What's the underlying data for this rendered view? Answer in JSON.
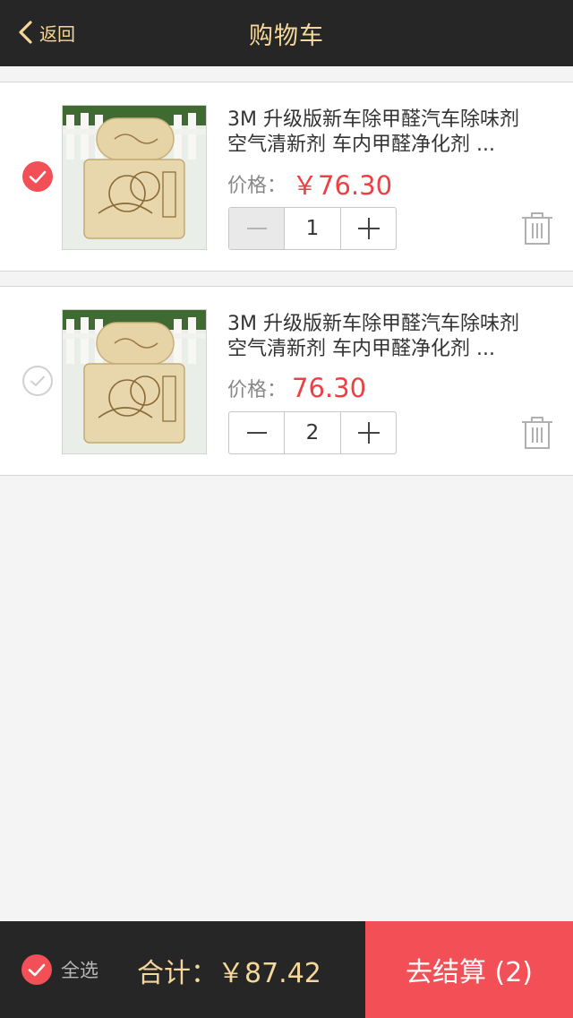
{
  "header": {
    "back_label": "返回",
    "title": "购物车"
  },
  "colors": {
    "header_bg": "#262626",
    "header_text": "#f5d79a",
    "accent": "#f24f57",
    "price": "#ee4042",
    "background": "#f4f4f4"
  },
  "icons": {
    "back": "chevron-left-icon",
    "check": "check-circle-icon",
    "minus": "minus-icon",
    "plus": "plus-icon",
    "trash": "trash-icon"
  },
  "items": [
    {
      "checked": true,
      "name_line1": "3M 升级版新车除甲醛汽车除味剂",
      "name_line2": "空气清新剂 车内甲醛净化剂 ...",
      "price_label": "价格：",
      "price": "￥76.30",
      "quantity": "1",
      "minus_disabled": true
    },
    {
      "checked": false,
      "name_line1": "3M 升级版新车除甲醛汽车除味剂",
      "name_line2": "空气清新剂 车内甲醛净化剂 ...",
      "price_label": "价格：",
      "price": "76.30",
      "quantity": "2",
      "minus_disabled": false
    }
  ],
  "footer": {
    "select_all_label": "全选",
    "select_all_checked": true,
    "total": "合计：￥87.42",
    "checkout_label": "去结算 (2)"
  }
}
